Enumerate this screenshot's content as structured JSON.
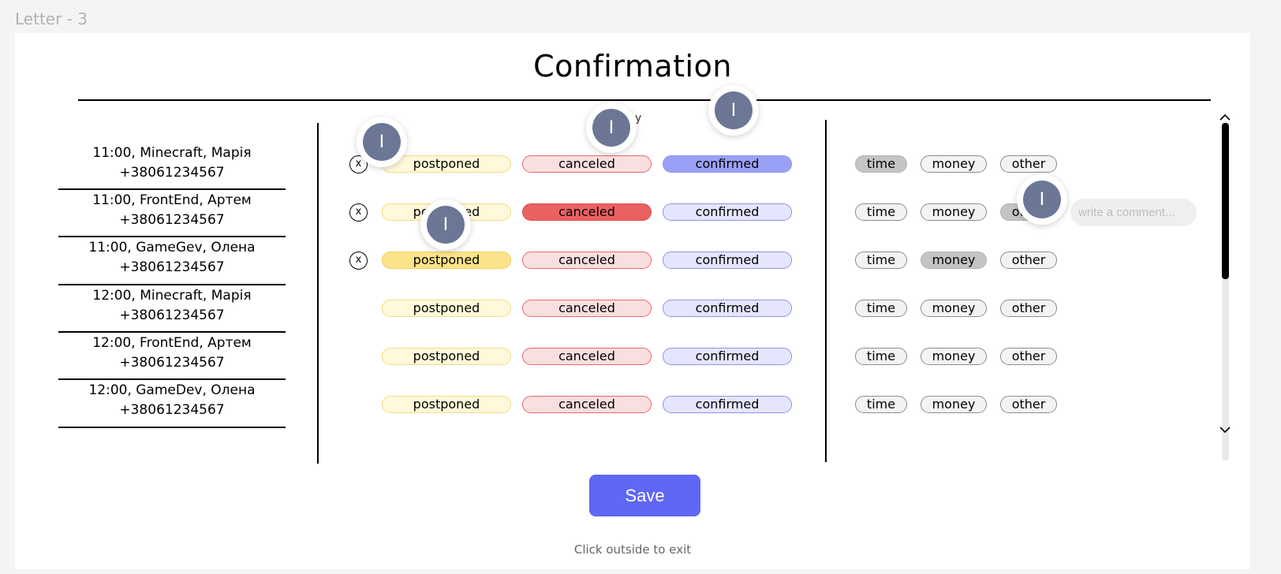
{
  "frame_label": "Letter - 3",
  "title": "Confirmation",
  "partial_text": "y",
  "contacts": [
    {
      "line1": "11:00, Minecraft, Марія",
      "line2": "+38061234567"
    },
    {
      "line1": "11:00, FrontEnd, Артем",
      "line2": "+38061234567"
    },
    {
      "line1": "11:00, GameGev, Олена",
      "line2": "+38061234567"
    },
    {
      "line1": "12:00, Minecraft, Марія",
      "line2": "+38061234567"
    },
    {
      "line1": "12:00, FrontEnd, Артем",
      "line2": "+38061234567"
    },
    {
      "line1": "12:00, GameDev, Олена",
      "line2": "+38061234567"
    }
  ],
  "status_labels": {
    "postponed": "postponed",
    "canceled": "canceled",
    "confirmed": "confirmed"
  },
  "reason_labels": {
    "time": "time",
    "money": "money",
    "other": "other"
  },
  "clear_label": "x",
  "rows": [
    {
      "status": "confirmed",
      "reason": "time",
      "clear": true
    },
    {
      "status": "canceled",
      "reason": "other",
      "clear": true
    },
    {
      "status": "postponed",
      "reason": "money",
      "clear": true
    },
    {
      "status": "",
      "reason": "",
      "clear": false
    },
    {
      "status": "",
      "reason": "",
      "clear": false
    },
    {
      "status": "",
      "reason": "",
      "clear": false
    }
  ],
  "comment_placeholder": "write a comment...",
  "save_label": "Save",
  "hint": "Click outside to exit",
  "cursor_letter": "I",
  "colors": {
    "accent": "#5f67f4",
    "postponed_active": "#fbe38c",
    "canceled_active": "#ea6161",
    "confirmed_active": "#9aa0f6",
    "reason_active": "#c4c4c4",
    "cursor": "#6b7795"
  },
  "icons": {
    "scroll_up": "chevron-up-icon",
    "scroll_down": "chevron-down-icon",
    "cursor": "collaborator-cursor-icon"
  }
}
